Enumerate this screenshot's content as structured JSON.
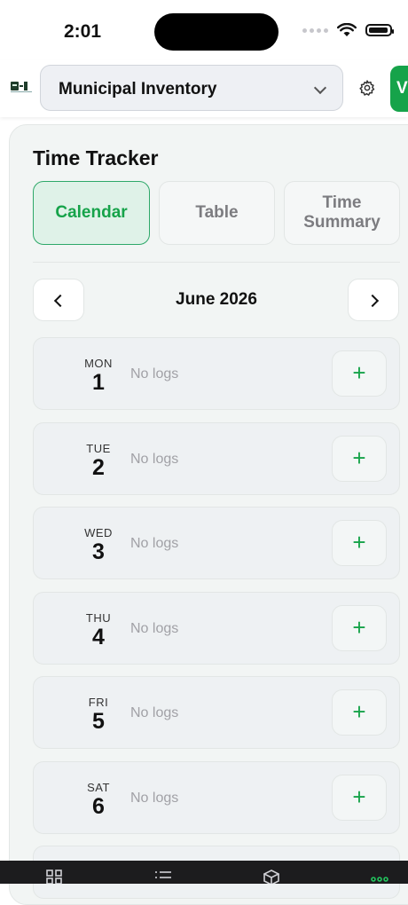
{
  "status_bar": {
    "time": "2:01"
  },
  "header": {
    "project_selector": "Municipal Inventory",
    "avatar_initial": "V"
  },
  "page": {
    "title": "Time Tracker",
    "tabs": [
      {
        "label": "Calendar",
        "active": true
      },
      {
        "label": "Table",
        "active": false
      },
      {
        "label": "Time\nSummary",
        "active": false
      }
    ]
  },
  "calendar": {
    "month_label": "June 2026",
    "days": [
      {
        "weekday": "MON",
        "date": "1",
        "status": "No logs"
      },
      {
        "weekday": "TUE",
        "date": "2",
        "status": "No logs"
      },
      {
        "weekday": "WED",
        "date": "3",
        "status": "No logs"
      },
      {
        "weekday": "THU",
        "date": "4",
        "status": "No logs"
      },
      {
        "weekday": "FRI",
        "date": "5",
        "status": "No logs"
      },
      {
        "weekday": "SAT",
        "date": "6",
        "status": "No logs"
      }
    ],
    "add_symbol": "+"
  },
  "colors": {
    "accent": "#16a34a",
    "active_tab_bg": "#dff2e8",
    "tabbar_bg": "#1c1c1e"
  },
  "bottom_tabs": [
    {
      "icon": "grid-icon"
    },
    {
      "icon": "list-icon"
    },
    {
      "icon": "box-icon"
    },
    {
      "icon": "more-icon",
      "active": true
    }
  ]
}
